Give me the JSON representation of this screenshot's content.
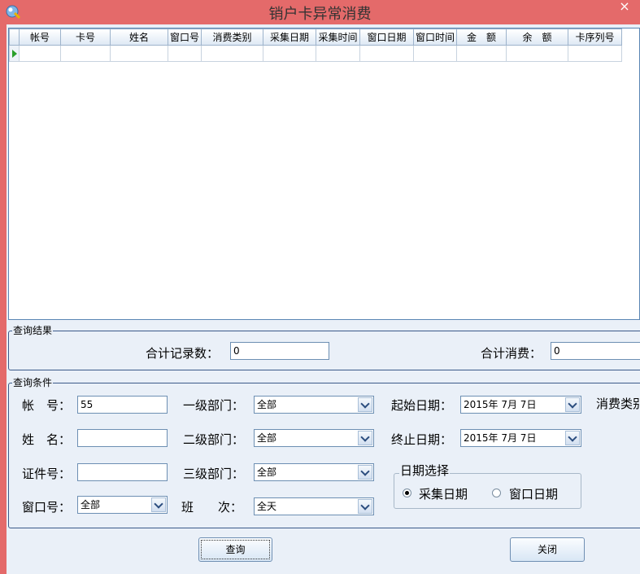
{
  "window": {
    "title": "销户卡异常消费",
    "close_label": "×"
  },
  "grid": {
    "columns": [
      "帐号",
      "卡号",
      "姓名",
      "窗口号",
      "消费类别",
      "采集日期",
      "采集时间",
      "窗口日期",
      "窗口时间",
      "金　额",
      "余　额",
      "卡序列号"
    ]
  },
  "results": {
    "group_label": "查询结果",
    "total_records_label": "合计记录数：",
    "total_records_value": "0",
    "total_consumption_label": "合计消费：",
    "total_consumption_value": "0"
  },
  "conditions": {
    "group_label": "查询条件",
    "account_label": "帐　号：",
    "account_value": "55",
    "name_label": "姓　名：",
    "name_value": "",
    "id_label": "证件号：",
    "id_value": "",
    "window_label": "窗口号：",
    "window_value": "全部",
    "dept1_label": "一级部门：",
    "dept1_value": "全部",
    "dept2_label": "二级部门：",
    "dept2_value": "全部",
    "dept3_label": "三级部门：",
    "dept3_value": "全部",
    "shift_label": "班　　次：",
    "shift_value": "全天",
    "start_date_label": "起始日期：",
    "start_date_value": "2015年 7月 7日",
    "end_date_label": "终止日期：",
    "end_date_value": "2015年 7月 7日",
    "category_label": "消费类别",
    "date_choice": {
      "group_label": "日期选择",
      "option_collect": "采集日期",
      "option_window": "窗口日期"
    }
  },
  "buttons": {
    "query": "查询",
    "close": "关闭"
  }
}
